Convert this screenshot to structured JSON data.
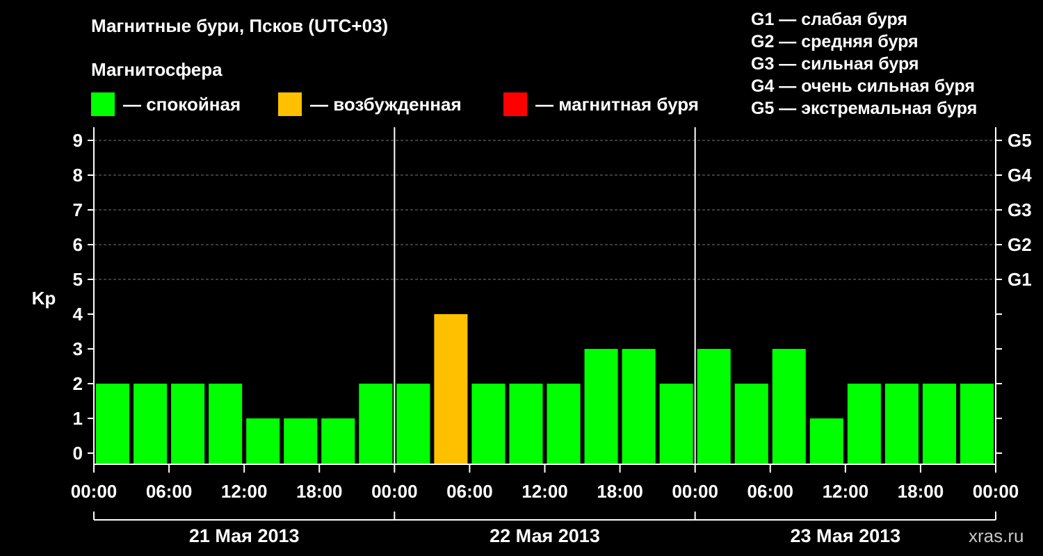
{
  "title": "Магнитные бури, Псков (UTC+03)",
  "subtitle": "Магнитосфера",
  "legend": [
    {
      "label": "— спокойная",
      "color": "#00ff00"
    },
    {
      "label": "— возбужденная",
      "color": "#ffc000"
    },
    {
      "label": "— магнитная буря",
      "color": "#ff0000"
    }
  ],
  "g_legend": [
    "G1 — слабая буря",
    "G2 — средняя буря",
    "G3 — сильная буря",
    "G4 — очень сильная буря",
    "G5 — экстремальная буря"
  ],
  "watermark": "xras.ru",
  "chart_data": {
    "type": "bar",
    "ylabel": "Kp",
    "ylim": [
      0,
      9
    ],
    "yticks": [
      "0",
      "1",
      "2",
      "3",
      "4",
      "5",
      "6",
      "7",
      "8",
      "9"
    ],
    "right_ticks": [
      {
        "value": 5,
        "label": "G1"
      },
      {
        "value": 6,
        "label": "G2"
      },
      {
        "value": 7,
        "label": "G3"
      },
      {
        "value": 8,
        "label": "G4"
      },
      {
        "value": 9,
        "label": "G5"
      }
    ],
    "grid": true,
    "xticks": [
      "00:00",
      "06:00",
      "12:00",
      "18:00",
      "00:00",
      "06:00",
      "12:00",
      "18:00",
      "00:00",
      "06:00",
      "12:00",
      "18:00",
      "00:00"
    ],
    "days": [
      "21 Мая 2013",
      "22 Мая 2013",
      "23 Мая 2013"
    ],
    "values": [
      2,
      2,
      2,
      2,
      1,
      1,
      1,
      2,
      2,
      4,
      2,
      2,
      2,
      3,
      3,
      2,
      3,
      2,
      3,
      1,
      2,
      2,
      2,
      2
    ],
    "colors": [
      "#00ff00",
      "#00ff00",
      "#00ff00",
      "#00ff00",
      "#00ff00",
      "#00ff00",
      "#00ff00",
      "#00ff00",
      "#00ff00",
      "#ffc000",
      "#00ff00",
      "#00ff00",
      "#00ff00",
      "#00ff00",
      "#00ff00",
      "#00ff00",
      "#00ff00",
      "#00ff00",
      "#00ff00",
      "#00ff00",
      "#00ff00",
      "#00ff00",
      "#00ff00",
      "#00ff00"
    ]
  }
}
